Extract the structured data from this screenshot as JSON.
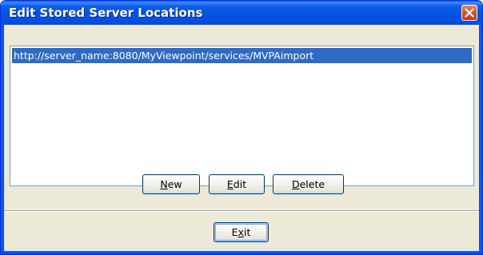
{
  "window": {
    "title": "Edit Stored Server Locations"
  },
  "server_list": {
    "items": [
      {
        "label": "http://server_name:8080/MyViewpoint/services/MVPAimport",
        "selected": true
      }
    ]
  },
  "buttons": {
    "new": {
      "pre": "",
      "mnemonic": "N",
      "post": "ew"
    },
    "edit": {
      "pre": "",
      "mnemonic": "E",
      "post": "dit"
    },
    "delete": {
      "pre": "",
      "mnemonic": "D",
      "post": "elete"
    },
    "exit": {
      "pre": "E",
      "mnemonic": "x",
      "post": "it"
    }
  },
  "colors": {
    "titlebar": "#0553e0",
    "selection": "#316ac5",
    "dialog_bg": "#ece9d8",
    "close_button": "#d8532f"
  },
  "icons": {
    "close": "close-icon"
  }
}
